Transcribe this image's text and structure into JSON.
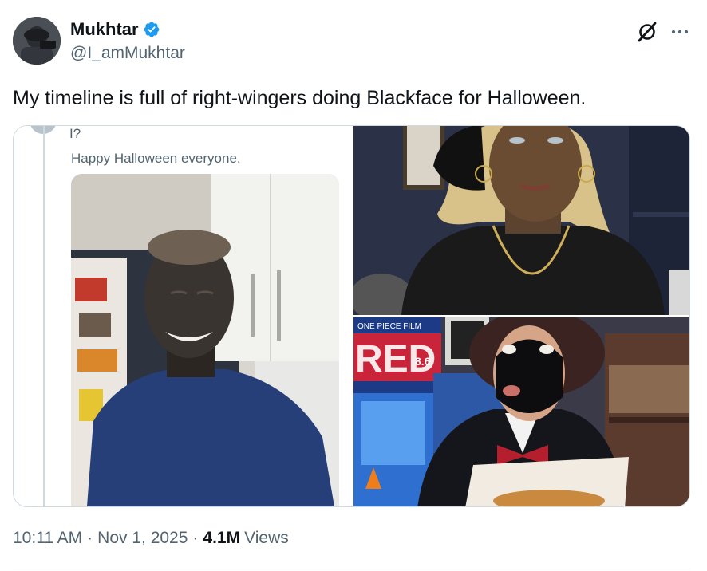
{
  "author": {
    "display_name": "Mukhtar",
    "handle": "@I_amMukhtar",
    "verified": true,
    "avatar_icon": "user-avatar"
  },
  "header_actions": {
    "grok_icon": "grok-icon",
    "more_icon": "more-options-icon"
  },
  "tweet": {
    "text": "My timeline is full of right-wingers doing Blackface for Halloween."
  },
  "media": {
    "left_screenshot": {
      "crop_line": "I?",
      "text": "Happy Halloween everyone."
    },
    "bottom_right_poster": {
      "title": "RED",
      "subtitle": "ONE PIECE FILM",
      "score": "8.6"
    }
  },
  "meta": {
    "time": "10:11 AM",
    "date": "Nov 1, 2025",
    "views_count": "4.1M",
    "views_label": "Views",
    "separator": "·"
  },
  "colors": {
    "text_primary": "#0f1419",
    "text_secondary": "#536471",
    "verified_blue": "#1d9bf0",
    "border": "#cfd9de"
  }
}
